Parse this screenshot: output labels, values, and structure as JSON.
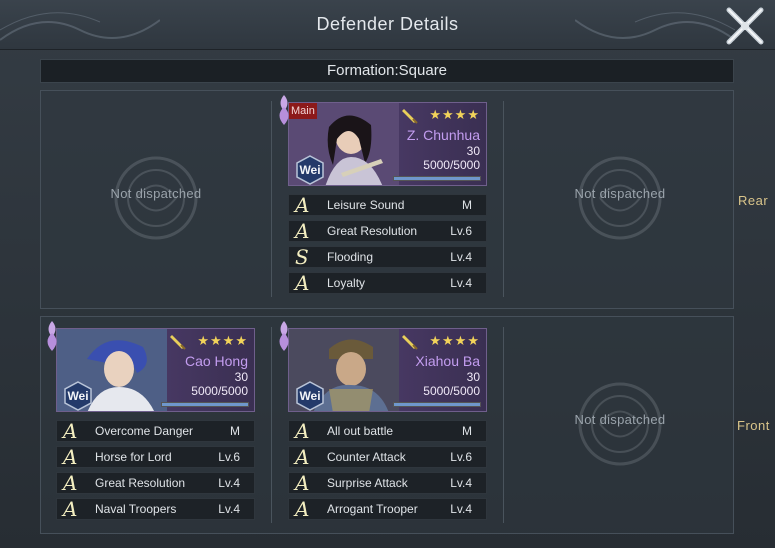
{
  "window": {
    "title": "Defender Details"
  },
  "formation": {
    "label": "Formation:Square"
  },
  "rows": [
    {
      "label": "Rear",
      "slots": [
        {
          "type": "empty",
          "text": "Not dispatched"
        },
        {
          "type": "hero",
          "main_badge": "Main",
          "stars": "★★★★",
          "name": "Z. Chunhua",
          "level": "30",
          "troops": "5000/5000",
          "troop_fraction": 1.0,
          "faction": "Wei",
          "portrait_color": "#5a4a74",
          "skills": [
            {
              "grade": "A",
              "name": "Leisure Sound",
              "level": "M"
            },
            {
              "grade": "A",
              "name": "Great Resolution",
              "level": "Lv.6"
            },
            {
              "grade": "S",
              "name": "Flooding",
              "level": "Lv.4"
            },
            {
              "grade": "A",
              "name": "Loyalty",
              "level": "Lv.4"
            }
          ]
        },
        {
          "type": "empty",
          "text": "Not dispatched"
        }
      ]
    },
    {
      "label": "Front",
      "slots": [
        {
          "type": "hero",
          "main_badge": "",
          "stars": "★★★★",
          "name": "Cao Hong",
          "level": "30",
          "troops": "5000/5000",
          "troop_fraction": 1.0,
          "faction": "Wei",
          "portrait_color": "#4e5f86",
          "skills": [
            {
              "grade": "A",
              "name": "Overcome Danger",
              "level": "M"
            },
            {
              "grade": "A",
              "name": "Horse for Lord",
              "level": "Lv.6"
            },
            {
              "grade": "A",
              "name": "Great Resolution",
              "level": "Lv.4"
            },
            {
              "grade": "A",
              "name": "Naval Troopers",
              "level": "Lv.4"
            }
          ]
        },
        {
          "type": "hero",
          "main_badge": "",
          "stars": "★★★★",
          "name": "Xiahou Ba",
          "level": "30",
          "troops": "5000/5000",
          "troop_fraction": 1.0,
          "faction": "Wei",
          "portrait_color": "#4b4a5e",
          "skills": [
            {
              "grade": "A",
              "name": "All out battle",
              "level": "M"
            },
            {
              "grade": "A",
              "name": "Counter Attack",
              "level": "Lv.6"
            },
            {
              "grade": "A",
              "name": "Surprise Attack",
              "level": "Lv.4"
            },
            {
              "grade": "A",
              "name": "Arrogant Trooper",
              "level": "Lv.4"
            }
          ]
        },
        {
          "type": "empty",
          "text": "Not dispatched"
        }
      ]
    }
  ],
  "icons": {
    "close": "close-x-icon",
    "weapon": "sword-icon",
    "faction": "shield-badge-icon",
    "empty_emblem": "dragon-emblem-icon",
    "flower": "flower-icon"
  },
  "colors": {
    "accent_name": "#c39df0",
    "stars": "#f2d35a",
    "row_label": "#d9c48a",
    "troop_fill": "#6f97cc",
    "main_badge": "#8c1a1a"
  }
}
